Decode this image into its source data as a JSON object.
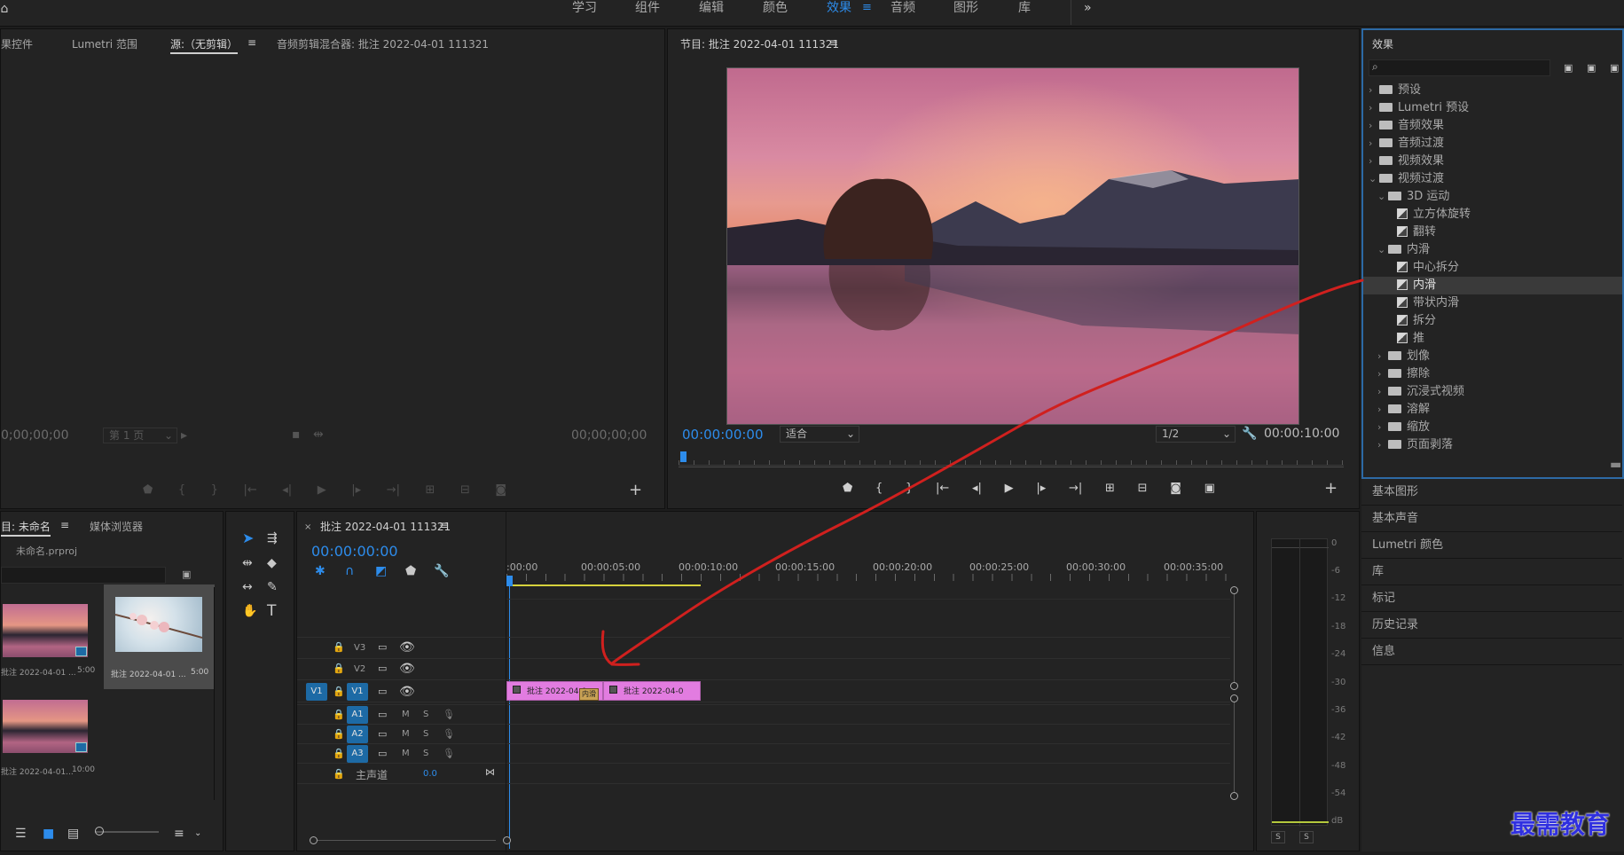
{
  "workspaces": [
    "学习",
    "组件",
    "编辑",
    "颜色",
    "效果",
    "音频",
    "图形",
    "库"
  ],
  "workspaces_active": "效果",
  "more_glyph": "»",
  "source": {
    "tabs": [
      "果控件",
      "Lumetri 范围",
      "源:（无剪辑）",
      "音频剪辑混合器: 批注 2022-04-01 111321"
    ],
    "tc_left": "0;00;00;00",
    "page_select": "第 1 页",
    "tc_right": "00;00;00;00"
  },
  "program": {
    "title": "节目: 批注 2022-04-01 111321",
    "tc_current": "00:00:00:00",
    "fit": "适合",
    "res": "1/2",
    "tc_duration": "00:00:10:00"
  },
  "effects": {
    "title": "效果",
    "items": [
      {
        "label": "预设",
        "type": "folder",
        "level": 0,
        "open": false
      },
      {
        "label": "Lumetri 预设",
        "type": "folder",
        "level": 0,
        "open": false
      },
      {
        "label": "音频效果",
        "type": "folder",
        "level": 0,
        "open": false
      },
      {
        "label": "音频过渡",
        "type": "folder",
        "level": 0,
        "open": false
      },
      {
        "label": "视频效果",
        "type": "folder",
        "level": 0,
        "open": false
      },
      {
        "label": "视频过渡",
        "type": "folder",
        "level": 0,
        "open": true
      },
      {
        "label": "3D 运动",
        "type": "folder",
        "level": 1,
        "open": true
      },
      {
        "label": "立方体旋转",
        "type": "transition",
        "level": 2
      },
      {
        "label": "翻转",
        "type": "transition",
        "level": 2
      },
      {
        "label": "内滑",
        "type": "folder",
        "level": 1,
        "open": true
      },
      {
        "label": "中心拆分",
        "type": "transition",
        "level": 2
      },
      {
        "label": "内滑",
        "type": "transition",
        "level": 2,
        "selected": true
      },
      {
        "label": "带状内滑",
        "type": "transition",
        "level": 2
      },
      {
        "label": "拆分",
        "type": "transition",
        "level": 2
      },
      {
        "label": "推",
        "type": "transition",
        "level": 2
      },
      {
        "label": "划像",
        "type": "folder",
        "level": 1,
        "open": false
      },
      {
        "label": "擦除",
        "type": "folder",
        "level": 1,
        "open": false
      },
      {
        "label": "沉浸式视频",
        "type": "folder",
        "level": 1,
        "open": false
      },
      {
        "label": "溶解",
        "type": "folder",
        "level": 1,
        "open": false
      },
      {
        "label": "缩放",
        "type": "folder",
        "level": 1,
        "open": false
      },
      {
        "label": "页面剥落",
        "type": "folder",
        "level": 1,
        "open": false
      }
    ]
  },
  "right_panels": [
    "基本图形",
    "基本声音",
    "Lumetri 颜色",
    "库",
    "标记",
    "历史记录",
    "信息"
  ],
  "project": {
    "tabs": [
      "目: 未命名",
      "媒体浏览器"
    ],
    "file": "未命名.prproj",
    "items": [
      {
        "name": "批注 2022-04-01 ...",
        "dur": "5:00"
      },
      {
        "name": "批注 2022-04-01 ...",
        "dur": "5:00"
      },
      {
        "name": "批注 2022-04-01...",
        "dur": "10:00"
      }
    ]
  },
  "timeline": {
    "title": "批注 2022-04-01 111321",
    "timecode": "00:00:00:00",
    "ruler": [
      ":00:00",
      "00:00:05:00",
      "00:00:10:00",
      "00:00:15:00",
      "00:00:20:00",
      "00:00:25:00",
      "00:00:30:00",
      "00:00:35:00"
    ],
    "video_tracks": [
      "V3",
      "V2",
      "V1"
    ],
    "audio_tracks": [
      "A1",
      "A2",
      "A3"
    ],
    "source_patch": "V1",
    "mute": "M",
    "solo": "S",
    "master": "主声道",
    "master_vol": "0.0",
    "clips": [
      "批注 2022-04-0",
      "批注 2022-04-0"
    ],
    "transition_label": "内滑"
  },
  "meter": {
    "scale": [
      "0",
      "-6",
      "-12",
      "-18",
      "-24",
      "-30",
      "-36",
      "-42",
      "-48",
      "-54",
      "dB"
    ],
    "solo": [
      "S",
      "S"
    ]
  },
  "watermark": "最需教育",
  "colors": {
    "accent": "#2d8ceb",
    "clip": "#e27ce0",
    "track_target": "#1d6aa5",
    "annotation": "#d0201e"
  }
}
